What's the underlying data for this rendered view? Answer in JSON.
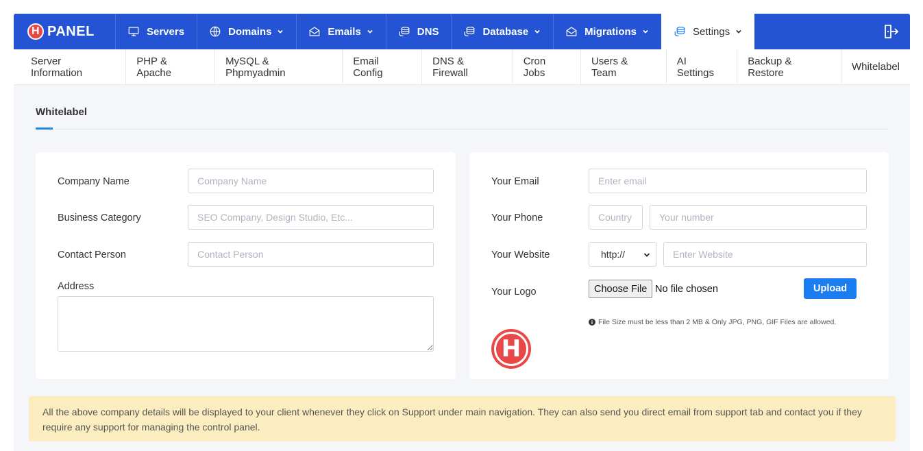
{
  "brand": {
    "badge": "H",
    "name": "PANEL"
  },
  "nav": [
    {
      "label": "Servers",
      "icon": "monitor-icon",
      "dropdown": false
    },
    {
      "label": "Domains",
      "icon": "globe-icon",
      "dropdown": true
    },
    {
      "label": "Emails",
      "icon": "envelope-icon",
      "dropdown": true
    },
    {
      "label": "DNS",
      "icon": "database-icon",
      "dropdown": false
    },
    {
      "label": "Database",
      "icon": "database-icon",
      "dropdown": true
    },
    {
      "label": "Migrations",
      "icon": "envelope-icon",
      "dropdown": true
    },
    {
      "label": "Settings",
      "icon": "database-icon",
      "dropdown": true,
      "active": true
    }
  ],
  "subnav": [
    "Server Information",
    "PHP & Apache",
    "MySQL & Phpmyadmin",
    "Email Config",
    "DNS & Firewall",
    "Cron Jobs",
    "Users & Team",
    "AI Settings",
    "Backup & Restore",
    "Whitelabel"
  ],
  "page": {
    "title": "Whitelabel"
  },
  "left_form": {
    "company_name": {
      "label": "Company Name",
      "placeholder": "Company Name",
      "value": ""
    },
    "business_category": {
      "label": "Business Category",
      "placeholder": "SEO Company, Design Studio, Etc...",
      "value": ""
    },
    "contact_person": {
      "label": "Contact Person",
      "placeholder": "Contact Person",
      "value": ""
    },
    "address": {
      "label": "Address",
      "value": ""
    }
  },
  "right_form": {
    "email": {
      "label": "Your Email",
      "placeholder": "Enter email",
      "value": ""
    },
    "phone": {
      "label": "Your Phone",
      "country_placeholder": "Country",
      "number_placeholder": "Your number"
    },
    "website": {
      "label": "Your Website",
      "protocol": "http://",
      "placeholder": "Enter Website"
    },
    "logo": {
      "label": "Your Logo",
      "choose_label": "Choose File",
      "no_file": "No file chosen",
      "upload_label": "Upload",
      "hint": "File Size must be less than 2 MB & Only JPG, PNG, GIF Files are allowed.",
      "preview_letter": "H"
    }
  },
  "notice": "All the above company details will be displayed to your client whenever they click on Support under main navigation. They can also send you direct email from support tab and contact you if they require any support for managing the control panel.",
  "colors": {
    "nav_bg": "#2453d3",
    "accent": "#1a7ef0",
    "brand_red": "#e94545",
    "notice_bg": "#fbedbf"
  }
}
